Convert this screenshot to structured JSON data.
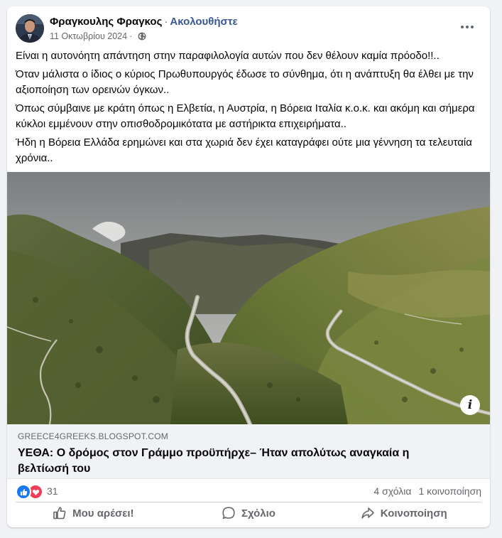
{
  "post": {
    "author_name": "Φραγκουλης Φραγκος",
    "separator": "·",
    "follow_label": "Ακολουθήστε",
    "date": "11 Οκτωβρίου 2024",
    "more_icon": "more-horizontal-icon",
    "privacy_icon": "globe-icon",
    "paragraphs": [
      "Είναι η αυτονόητη απάντηση στην παραφιλολογία αυτών που δεν θέλουν καμία πρόοδο!!..",
      "Όταν μάλιστα ο ίδιος ο κύριος Πρωθυπουργός έδωσε το σύνθημα, ότι η ανάπτυξη θα έλθει με την αξιοποίηση των ορεινών όγκων..",
      "Όπως σύμβαινε με κράτη όπως η Ελβετία, η Αυστρία, η Βόρεια Ιταλία κ.ο.κ. και ακόμη και σήμερα κύκλοι εμμένουν στην οπισθοδρομικότατα με αστήρικτα επιχειρήματα..",
      "Ήδη η Βόρεια Ελλάδα ερημώνει και στα χωριά δεν έχει καταγράφει ούτε μια γέννηση τα τελευταία χρόνια.."
    ]
  },
  "link_preview": {
    "domain": "GREECE4GREEKS.BLOGSPOT.COM",
    "title": "ΥΕΘΑ: Ο δρόμος στον Γράμμο προϋπήρχε– Ήταν απολύτως αναγκαία η βελτίωσή του",
    "info_icon": "info-icon",
    "info_label": "i"
  },
  "stats": {
    "reaction_count": "31",
    "comments": "4 σχόλια",
    "shares": "1 κοινοποίηση"
  },
  "actions": {
    "like_label": "Μου αρέσει!",
    "comment_label": "Σχόλιο",
    "share_label": "Κοινοποίηση"
  },
  "colors": {
    "link_blue": "#385898",
    "like_blue": "#1877f2",
    "love_red": "#f33e58",
    "secondary_text": "#65676b",
    "page_bg": "#f0f2f5"
  }
}
